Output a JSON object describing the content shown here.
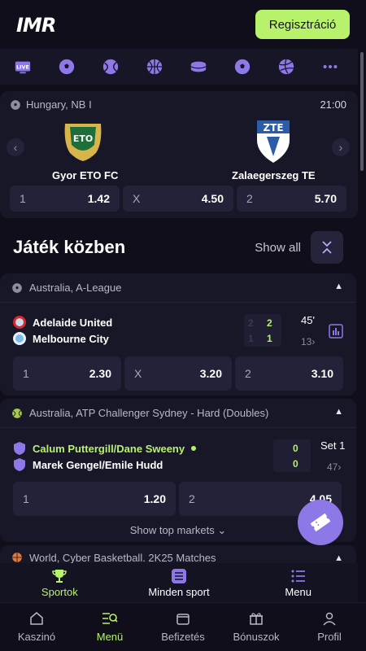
{
  "header": {
    "logo": "IMR",
    "register_label": "Regisztráció"
  },
  "sports_bar": {
    "icons": [
      "live-tv-icon",
      "soccer-ball-icon",
      "tennis-ball-icon",
      "basketball-icon",
      "hockey-puck-icon",
      "soccer-ball-icon",
      "volleyball-icon",
      "more-dots-icon"
    ],
    "live_badge": "LIVE"
  },
  "featured": {
    "league": "Hungary, NB I",
    "time": "21:00",
    "home": "Gyor ETO FC",
    "away": "Zalaegerszeg TE",
    "home_crest_text": "ETO",
    "away_crest_text": "ZTE",
    "odds": [
      {
        "label": "1",
        "value": "1.42"
      },
      {
        "label": "X",
        "value": "4.50"
      },
      {
        "label": "2",
        "value": "5.70"
      }
    ]
  },
  "in_play": {
    "title": "Játék közben",
    "show_all": "Show all"
  },
  "live_matches": [
    {
      "league": "Australia, A-League",
      "home": "Adelaide United",
      "away": "Melbourne City",
      "home_score_prev": "2",
      "away_score_prev": "1",
      "home_score": "2",
      "away_score": "1",
      "minute": "45'",
      "markets": "13›",
      "odds": [
        {
          "label": "1",
          "value": "2.30"
        },
        {
          "label": "X",
          "value": "3.20"
        },
        {
          "label": "2",
          "value": "3.10"
        }
      ]
    },
    {
      "league": "Australia, ATP Challenger Sydney - Hard (Doubles)",
      "home": "Calum Puttergill/Dane Sweeny",
      "away": "Marek Gengel/Emile Hudd",
      "home_score": "0",
      "away_score": "0",
      "minute": "Set 1",
      "markets": "47›",
      "odds": [
        {
          "label": "1",
          "value": "1.20"
        },
        {
          "label": "2",
          "value": "4.05"
        }
      ],
      "show_top": "Show top markets"
    },
    {
      "league": "World, Cyber Basketball. 2K25 Matches"
    }
  ],
  "sub_tabs": [
    {
      "label": "Sportok",
      "active": true
    },
    {
      "label": "Minden sport",
      "active": false
    },
    {
      "label": "Menu",
      "active": false
    }
  ],
  "bottom_nav": [
    {
      "label": "Kaszinó"
    },
    {
      "label": "Menü"
    },
    {
      "label": "Befizetés"
    },
    {
      "label": "Bónuszok"
    },
    {
      "label": "Profil"
    }
  ],
  "colors": {
    "accent": "#b8f26a",
    "purple": "#8e78e8",
    "bg": "#0f0e1a",
    "card": "#181727"
  }
}
